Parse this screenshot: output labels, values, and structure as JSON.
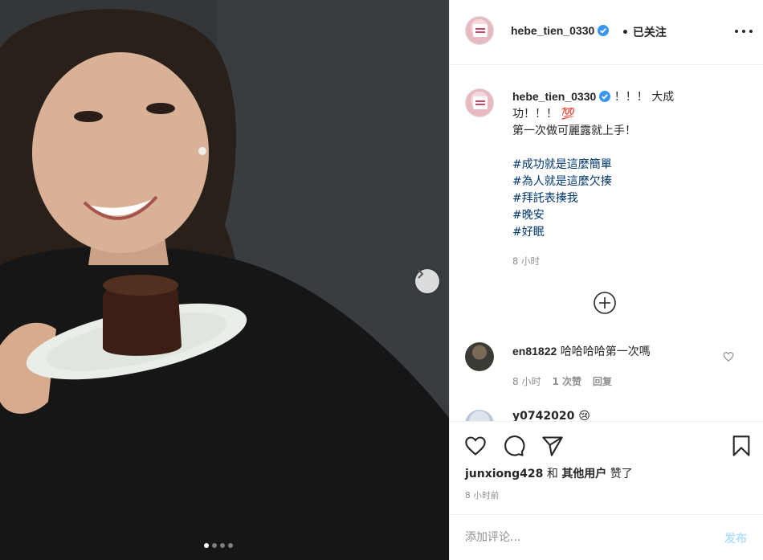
{
  "post": {
    "username": "hebe_tien_0330",
    "follow_state": "• 已关注",
    "caption_lines": [
      "！！！ 大成",
      "功！！！ 💯",
      "第一次做可麗露就上手！"
    ],
    "hashtags": [
      "#成功就是這麼簡單",
      "#為人就是這麼欠揍",
      "#拜託表揍我",
      "#晚安",
      "#好眠"
    ],
    "caption_time": "8 小时"
  },
  "comments": [
    {
      "username": "en81822",
      "text": "哈哈哈哈第一次嗎",
      "time": "8 小时",
      "likes": "1 次赞",
      "reply": "回复"
    },
    {
      "username": "y0742020 😢"
    }
  ],
  "likes": {
    "user": "junxiong428",
    "and": "和",
    "others": "其他用户",
    "suffix": "赞了"
  },
  "post_time": "8 小时前",
  "comment_box": {
    "placeholder": "添加评论...",
    "post_label": "发布"
  },
  "carousel": {
    "total": 4,
    "active": 1
  },
  "colors": {
    "link": "#00376b",
    "verified": "#3897f0",
    "post_disabled": "#b2dffc"
  }
}
